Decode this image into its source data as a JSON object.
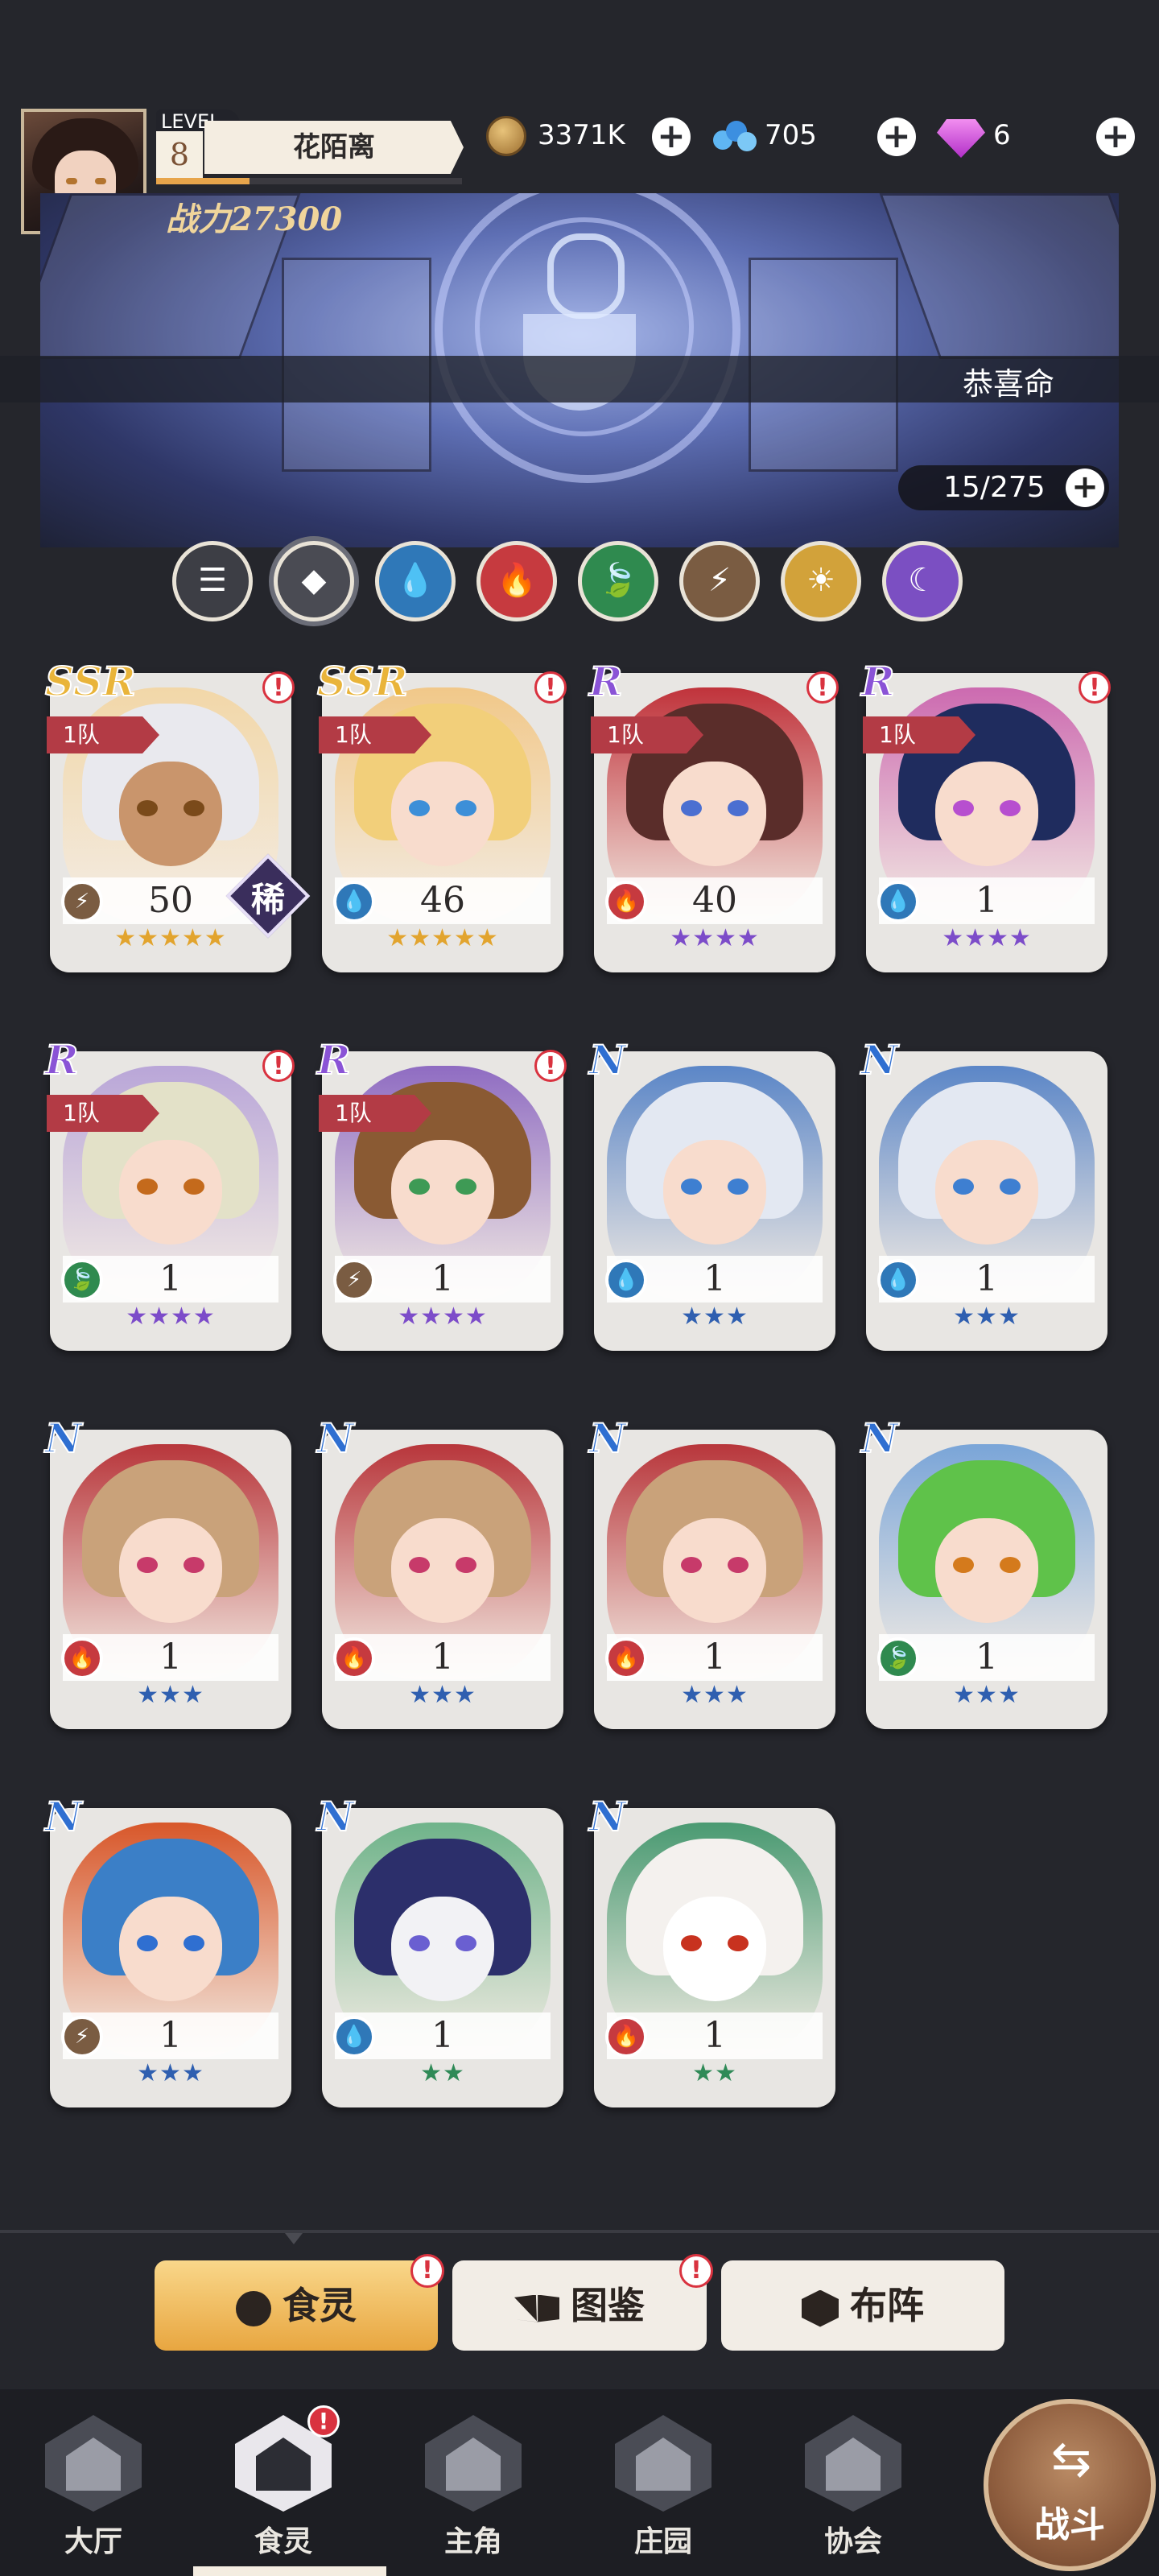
{
  "player": {
    "level_label": "LEVEL",
    "level": "8",
    "name": "花陌离",
    "power": "战力27300"
  },
  "resources": {
    "gold": "3371K",
    "crystal": "705",
    "gem": "6"
  },
  "banner": {
    "title": "恭喜命",
    "count": "15/275"
  },
  "filters": [
    {
      "name": "filter-all-icon",
      "glyph": "☰",
      "color": "#3d3e45"
    },
    {
      "name": "filter-rare-icon",
      "glyph": "◆",
      "color": "#4a4b53"
    },
    {
      "name": "filter-water-icon",
      "glyph": "💧",
      "color": "#2f78b8"
    },
    {
      "name": "filter-fire-icon",
      "glyph": "🔥",
      "color": "#c63a3f"
    },
    {
      "name": "filter-leaf-icon",
      "glyph": "🍃",
      "color": "#2f8a4f"
    },
    {
      "name": "filter-thunder-icon",
      "glyph": "⚡",
      "color": "#7a5c42"
    },
    {
      "name": "filter-sun-icon",
      "glyph": "☀",
      "color": "#d2a23a"
    },
    {
      "name": "filter-moon-icon",
      "glyph": "☾",
      "color": "#7b4fc2"
    }
  ],
  "cards": [
    {
      "rarity": "SSR",
      "team": "1队",
      "level": "50",
      "stars": "★★★★★",
      "element": "thunder",
      "alert": "!",
      "rare": "稀",
      "hair": "#e9e9ee",
      "bg": "#f2d7a8",
      "eye": "#7a4a1a",
      "portrait_face": "#c9956c",
      "star_color": "#e2a42e"
    },
    {
      "rarity": "SSR",
      "team": "1队",
      "level": "46",
      "stars": "★★★★★",
      "element": "water",
      "alert": "!",
      "rare": "",
      "hair": "#f2cf7a",
      "bg": "#f1c889",
      "eye": "#3d8fd8",
      "portrait_face": "#f8dccd",
      "star_color": "#e2a42e"
    },
    {
      "rarity": "R",
      "team": "1队",
      "level": "40",
      "stars": "★★★★",
      "element": "fire",
      "alert": "!",
      "rare": "",
      "hair": "#5a2d2a",
      "bg": "#c0333b",
      "eye": "#4b6fd1",
      "portrait_face": "#f8dccd",
      "star_color": "#7c4cc9"
    },
    {
      "rarity": "R",
      "team": "1队",
      "level": "1",
      "stars": "★★★★",
      "element": "water",
      "alert": "!",
      "rare": "",
      "hair": "#1f2c5e",
      "bg": "#cc6ab0",
      "eye": "#b74fcf",
      "portrait_face": "#f8dccd",
      "star_color": "#7c4cc9"
    },
    {
      "rarity": "R",
      "team": "1队",
      "level": "1",
      "stars": "★★★★",
      "element": "leaf",
      "alert": "!",
      "rare": "",
      "hair": "#e3e1c8",
      "bg": "#b9a6d8",
      "eye": "#c46a1c",
      "portrait_face": "#f8dccd",
      "star_color": "#7c4cc9"
    },
    {
      "rarity": "R",
      "team": "1队",
      "level": "1",
      "stars": "★★★★",
      "element": "thunder",
      "alert": "!",
      "rare": "",
      "hair": "#8a5a33",
      "bg": "#8f6cc2",
      "eye": "#3e9a55",
      "portrait_face": "#f8dccd",
      "star_color": "#7c4cc9"
    },
    {
      "rarity": "N",
      "team": "",
      "level": "1",
      "stars": "★★★",
      "element": "water",
      "alert": "",
      "rare": "",
      "hair": "#e3e8f2",
      "bg": "#5b86c7",
      "eye": "#3e7fd1",
      "portrait_face": "#f8dccd",
      "star_color": "#2f5fb0"
    },
    {
      "rarity": "N",
      "team": "",
      "level": "1",
      "stars": "★★★",
      "element": "water",
      "alert": "",
      "rare": "",
      "hair": "#e3e8f2",
      "bg": "#5b86c7",
      "eye": "#3e7fd1",
      "portrait_face": "#f8dccd",
      "star_color": "#2f5fb0"
    },
    {
      "rarity": "N",
      "team": "",
      "level": "1",
      "stars": "★★★",
      "element": "fire",
      "alert": "",
      "rare": "",
      "hair": "#c9a27a",
      "bg": "#b8363b",
      "eye": "#c73a6a",
      "portrait_face": "#f8dccd",
      "star_color": "#2f5fb0"
    },
    {
      "rarity": "N",
      "team": "",
      "level": "1",
      "stars": "★★★",
      "element": "fire",
      "alert": "",
      "rare": "",
      "hair": "#c9a27a",
      "bg": "#b8363b",
      "eye": "#c73a6a",
      "portrait_face": "#f8dccd",
      "star_color": "#2f5fb0"
    },
    {
      "rarity": "N",
      "team": "",
      "level": "1",
      "stars": "★★★",
      "element": "fire",
      "alert": "",
      "rare": "",
      "hair": "#c9a27a",
      "bg": "#b8363b",
      "eye": "#c73a6a",
      "portrait_face": "#f8dccd",
      "star_color": "#2f5fb0"
    },
    {
      "rarity": "N",
      "team": "",
      "level": "1",
      "stars": "★★★",
      "element": "leaf",
      "alert": "",
      "rare": "",
      "hair": "#5fc24a",
      "bg": "#7aa5d8",
      "eye": "#d47a1c",
      "portrait_face": "#f8dccd",
      "star_color": "#2f5fb0"
    },
    {
      "rarity": "N",
      "team": "",
      "level": "1",
      "stars": "★★★",
      "element": "thunder",
      "alert": "",
      "rare": "",
      "hair": "#3b7fc7",
      "bg": "#d8572a",
      "eye": "#2f6fd1",
      "portrait_face": "#f8dccd",
      "star_color": "#2f5fb0"
    },
    {
      "rarity": "N",
      "team": "",
      "level": "1",
      "stars": "★★",
      "element": "water",
      "alert": "",
      "rare": "",
      "hair": "#2c2f6b",
      "bg": "#6fb38a",
      "eye": "#6a5fd1",
      "portrait_face": "#f2f2f5",
      "star_color": "#2f8a57"
    },
    {
      "rarity": "N",
      "team": "",
      "level": "1",
      "stars": "★★",
      "element": "fire",
      "alert": "",
      "rare": "",
      "hair": "#f4f1ee",
      "bg": "#4a9a72",
      "eye": "#c8321f",
      "portrait_face": "#ffffff",
      "star_color": "#2f8a57"
    }
  ],
  "tabs": {
    "food_spirit": "食灵",
    "encyclopedia": "图鉴",
    "formation": "布阵",
    "alert": "!"
  },
  "nav": {
    "items": [
      "大厅",
      "食灵",
      "主角",
      "庄园",
      "协会"
    ],
    "fight": "战斗",
    "alert": "!"
  }
}
